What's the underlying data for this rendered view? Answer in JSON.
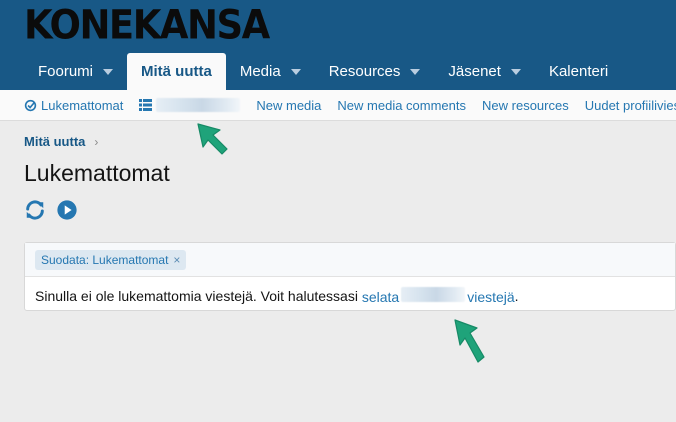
{
  "header": {
    "logo_text": "KONEKANSA"
  },
  "nav": {
    "tabs": [
      {
        "label": "Foorumi",
        "caret": true
      },
      {
        "label": "Mitä uutta",
        "caret": false,
        "active": true
      },
      {
        "label": "Media",
        "caret": true
      },
      {
        "label": "Resources",
        "caret": true
      },
      {
        "label": "Jäsenet",
        "caret": true
      },
      {
        "label": "Kalenteri",
        "caret": false
      }
    ]
  },
  "subnav": {
    "unread_label": "Lukemattomat",
    "new_media": "New media",
    "new_media_comments": "New media comments",
    "new_resources": "New resources",
    "profile_posts": "Uudet profiiliviest"
  },
  "breadcrumb": {
    "label": "Mitä uutta",
    "chevron": "›"
  },
  "page": {
    "title": "Lukemattomat"
  },
  "filter": {
    "chip_label": "Suodata: Lukemattomat",
    "chip_close": "×"
  },
  "message": {
    "text_before": "Sinulla ei ole lukemattomia viestejä. Voit halutessasi",
    "link_start": "selata",
    "link_end": "viestejä",
    "period": "."
  },
  "colors": {
    "header_bg": "#185886",
    "link": "#2577b1",
    "arrow": "#1fa37a"
  },
  "icons": {
    "refresh": "refresh-icon",
    "play": "play-icon",
    "unread": "unread-icon",
    "list": "list-icon"
  }
}
